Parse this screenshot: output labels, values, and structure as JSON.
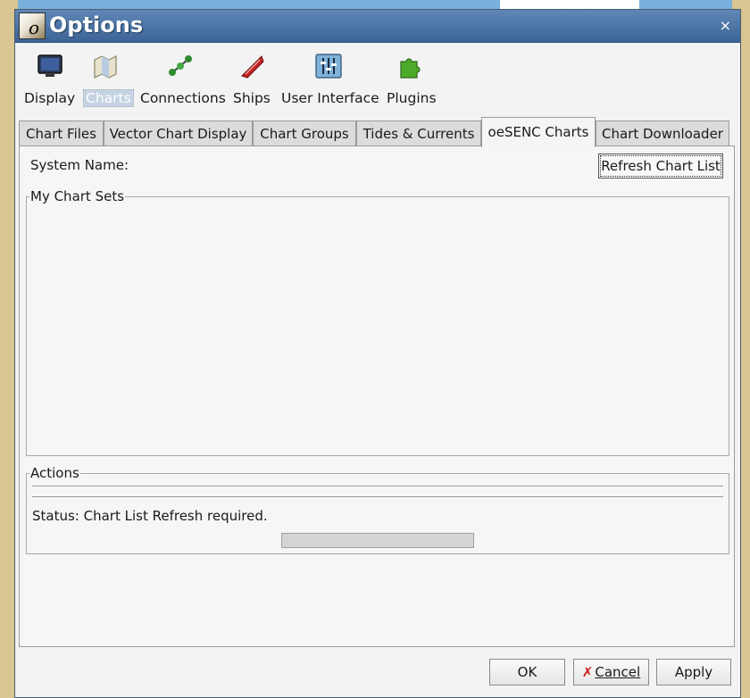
{
  "window": {
    "title": "Options",
    "logo_letter": "o",
    "close_glyph": "×"
  },
  "categories": [
    {
      "label": "Display",
      "icon": "monitor-icon",
      "selected": false
    },
    {
      "label": "Charts",
      "icon": "chart-map-icon",
      "selected": true
    },
    {
      "label": "Connections",
      "icon": "connections-icon",
      "selected": false
    },
    {
      "label": "Ships",
      "icon": "ship-icon",
      "selected": false
    },
    {
      "label": "User Interface",
      "icon": "sliders-icon",
      "selected": false
    },
    {
      "label": "Plugins",
      "icon": "puzzle-icon",
      "selected": false
    }
  ],
  "tabs": [
    {
      "label": "Chart Files",
      "active": false
    },
    {
      "label": "Vector Chart Display",
      "active": false
    },
    {
      "label": "Chart Groups",
      "active": false
    },
    {
      "label": "Tides & Currents",
      "active": false
    },
    {
      "label": "oeSENC Charts",
      "active": true
    },
    {
      "label": "Chart Downloader",
      "active": false
    }
  ],
  "panel": {
    "system_name_label": "System Name:",
    "refresh_button": "Refresh Chart List",
    "chart_sets_title": "My Chart Sets",
    "actions_title": "Actions",
    "status_text": "Status: Chart List Refresh required.",
    "progress": 0
  },
  "buttons": {
    "ok": "OK",
    "cancel_icon": "✗",
    "cancel": "Cancel",
    "apply": "Apply"
  },
  "colors": {
    "titlebar": "#4a74a6",
    "selected_category": "#c5d3e3",
    "cancel_icon": "#d01818"
  }
}
